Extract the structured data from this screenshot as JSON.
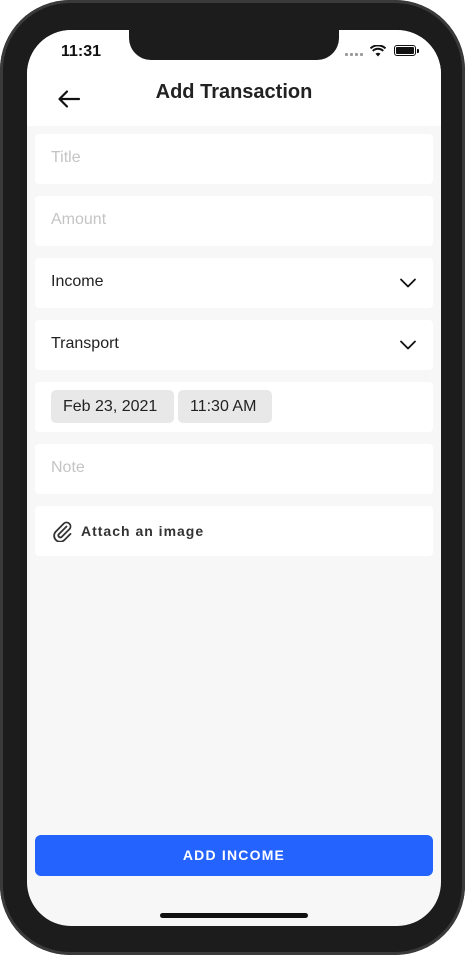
{
  "status_bar": {
    "time": "11:31"
  },
  "header": {
    "title": "Add Transaction"
  },
  "form": {
    "title_placeholder": "Title",
    "amount_placeholder": "Amount",
    "type_value": "Income",
    "category_value": "Transport",
    "date_value": "Feb 23, 2021",
    "time_value": "11:30 AM",
    "note_placeholder": "Note",
    "attach_label": "Attach an image"
  },
  "actions": {
    "submit_label": "ADD INCOME"
  },
  "colors": {
    "accent": "#2563ff",
    "background": "#f7f7f7"
  },
  "icons": [
    "back-arrow-icon",
    "chevron-down-icon",
    "paperclip-icon",
    "wifi-icon",
    "battery-icon"
  ]
}
